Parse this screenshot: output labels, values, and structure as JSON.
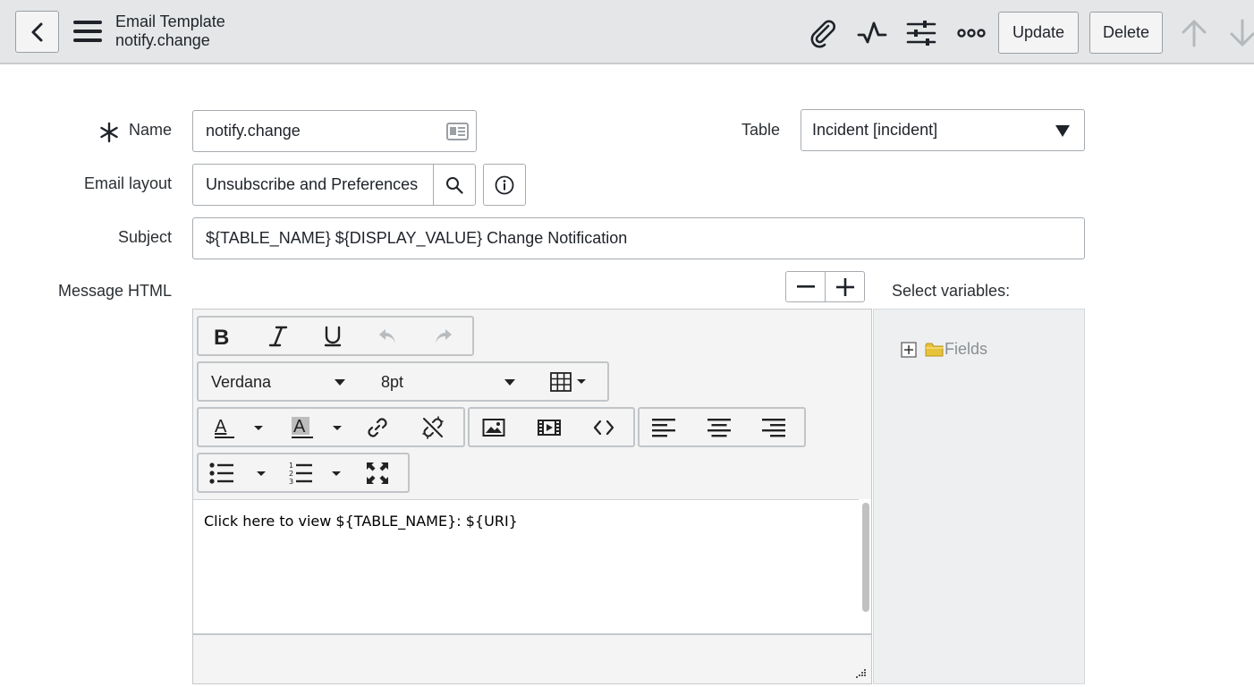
{
  "header": {
    "title": "Email Template",
    "subtitle": "notify.change",
    "update_label": "Update",
    "delete_label": "Delete"
  },
  "form": {
    "name_label": "Name",
    "name_value": "notify.change",
    "table_label": "Table",
    "table_value": "Incident [incident]",
    "email_layout_label": "Email layout",
    "email_layout_value": "Unsubscribe and Preferences",
    "subject_label": "Subject",
    "subject_value": "${TABLE_NAME} ${DISPLAY_VALUE} Change Notification",
    "message_label": "Message HTML"
  },
  "editor": {
    "font_family": "Verdana",
    "font_size": "8pt",
    "content": "Click here to view ${TABLE_NAME}: ${URI}"
  },
  "variables": {
    "title": "Select variables:",
    "tree_root": "Fields"
  },
  "colors": {
    "header_bg": "#e4e6e7",
    "folder": "#e8c23a"
  }
}
